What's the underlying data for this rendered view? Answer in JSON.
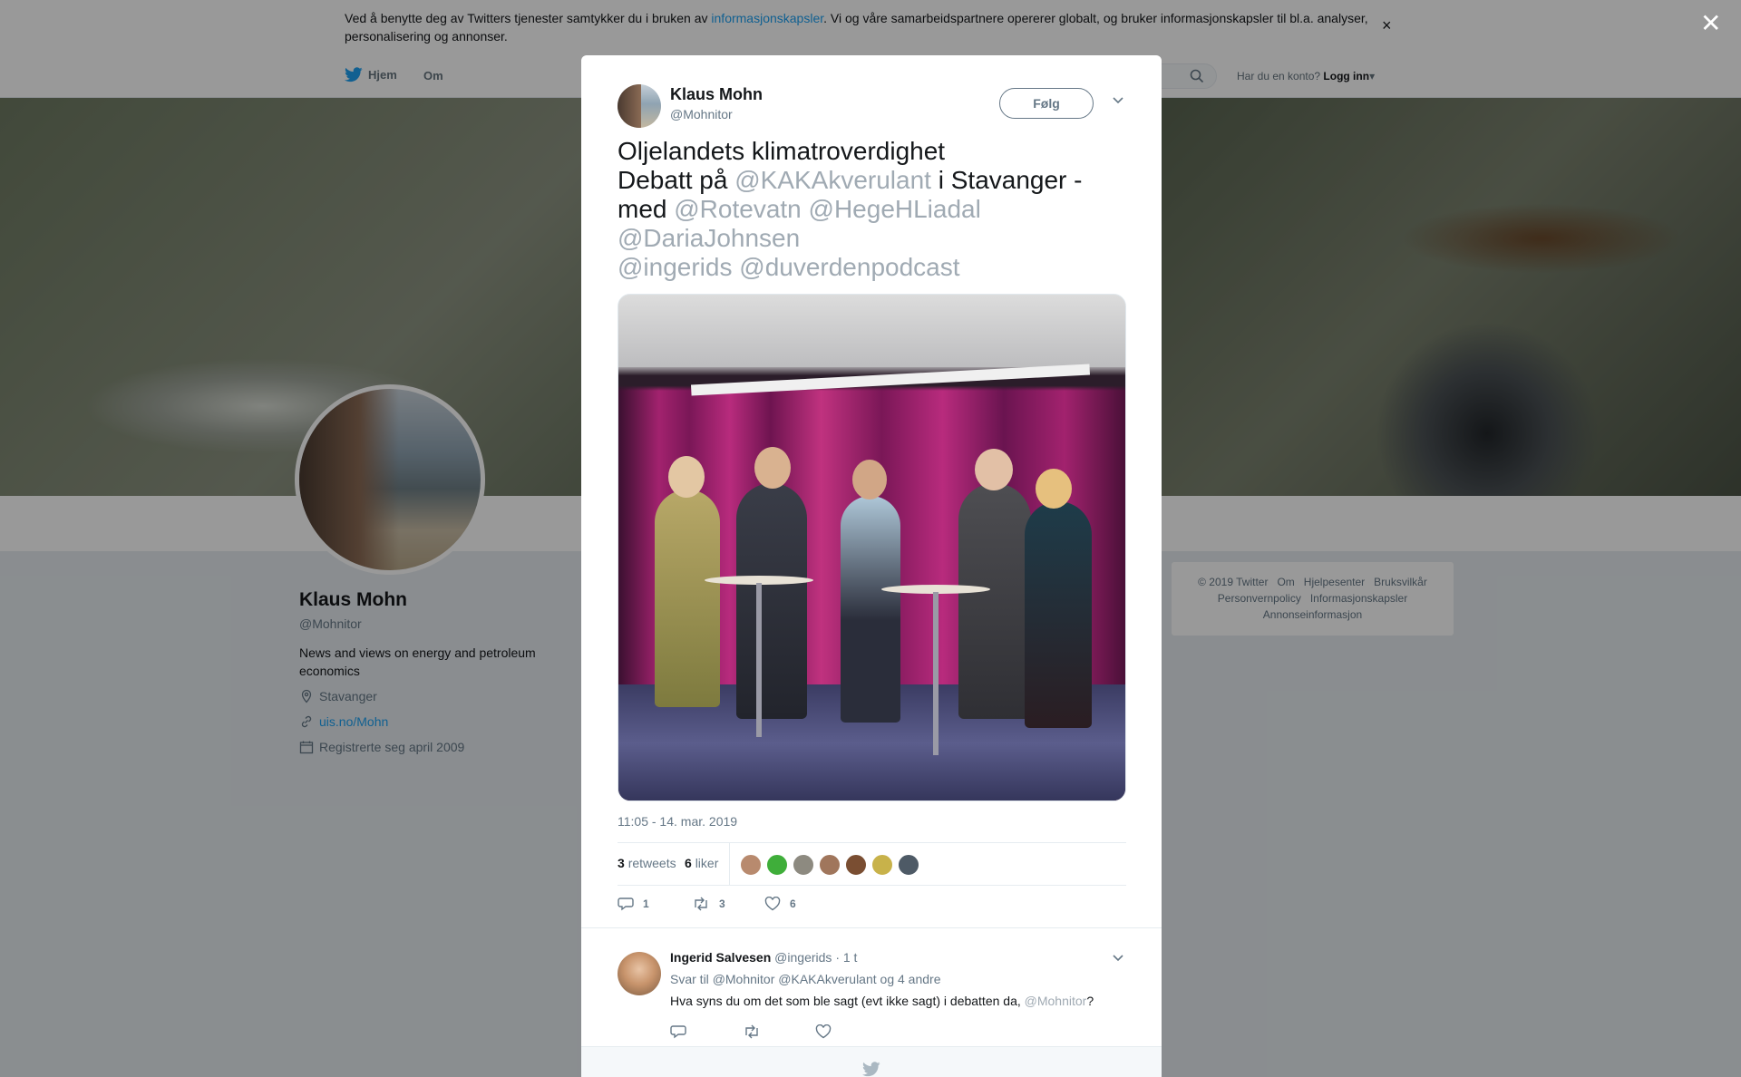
{
  "cookie_bar": {
    "text_before": "Ved å benytte deg av Twitters tjenester samtykker du i bruken av ",
    "link": "informasjonskapsler",
    "text_after": ". Vi og våre samarbeidspartnere opererer globalt, og bruker informasjonskapsler til bl.a. analyser, personalisering og annonser.",
    "close": "×"
  },
  "nav": {
    "home": "Hjem",
    "about": "Om",
    "login_prompt": "Har du en konto?",
    "login": "Logg inn"
  },
  "profile": {
    "name": "Klaus Mohn",
    "handle": "@Mohnitor",
    "bio": "News and views on energy and petroleum economics",
    "location": "Stavanger",
    "url": "uis.no/Mohn",
    "joined": "Registrerte seg april 2009"
  },
  "footer": {
    "links": [
      "© 2019 Twitter",
      "Om",
      "Hjelpesenter",
      "Bruksvilkår",
      "Personvernpolicy",
      "Informasjonskapsler",
      "Annonseinformasjon"
    ]
  },
  "overlay": {
    "close": "✕"
  },
  "tweet": {
    "author_name": "Klaus Mohn",
    "author_handle": "@Mohnitor",
    "follow": "Følg",
    "line1": "Oljelandets klimatroverdighet",
    "line2_a": "Debatt på ",
    "line2_mention": "@KAKAkverulant",
    "line2_b": " i Stavanger - med ",
    "mention_rotevatn": "@Rotevatn",
    "mention_hege": "@HegeHLiadal",
    "mention_daria": "@DariaJohnsen",
    "mention_ingerid": "@ingerids",
    "mention_podcast": "@duverdenpodcast",
    "timestamp": "11:05 - 14. mar. 2019",
    "retweets_count": "3",
    "retweets_label": "retweets",
    "likes_count": "6",
    "likes_label": "liker",
    "action_reply_count": "1",
    "action_rt_count": "3",
    "action_like_count": "6"
  },
  "likers": [
    {
      "color": "#b88a6e"
    },
    {
      "color": "#3fae3a"
    },
    {
      "color": "#8d8a80"
    },
    {
      "color": "#a0765c"
    },
    {
      "color": "#7a4e32"
    },
    {
      "color": "#c8b24a"
    },
    {
      "color": "#4e5a66"
    }
  ],
  "reply": {
    "name": "Ingerid Salvesen",
    "handle": "@ingerids",
    "time": "· 1 t",
    "reply_to_label": "Svar til",
    "reply_to_1": "@Mohnitor",
    "reply_to_2": "@KAKAkverulant",
    "reply_to_more": "og 4 andre",
    "body": "Hva syns du om det som ble sagt (evt ikke sagt) i debatten da, ",
    "body_mention": "@Mohnitor",
    "body_end": "?"
  }
}
